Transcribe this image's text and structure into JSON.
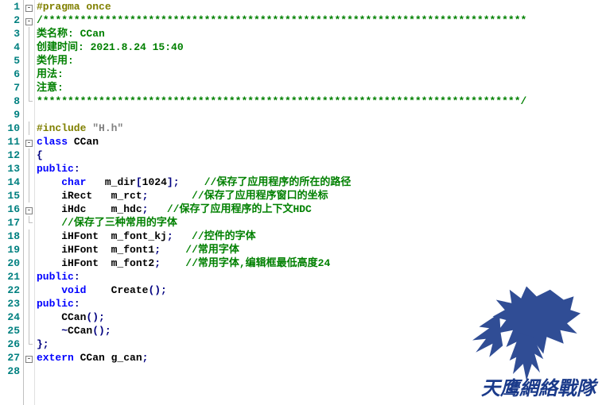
{
  "lines": [
    {
      "n": 1,
      "fold": "box",
      "segs": [
        {
          "c": "pp",
          "t": "#pragma once"
        }
      ]
    },
    {
      "n": 2,
      "fold": "box",
      "segs": [
        {
          "c": "cm",
          "t": "/******************************************************************************"
        }
      ]
    },
    {
      "n": 3,
      "fold": "line",
      "segs": [
        {
          "c": "cm",
          "t": "类名称: CCan"
        }
      ]
    },
    {
      "n": 4,
      "fold": "line",
      "segs": [
        {
          "c": "cm",
          "t": "创建时间: 2021.8.24 15:40"
        }
      ]
    },
    {
      "n": 5,
      "fold": "line",
      "segs": [
        {
          "c": "cm",
          "t": "类作用:"
        }
      ]
    },
    {
      "n": 6,
      "fold": "line",
      "segs": [
        {
          "c": "cm",
          "t": "用法:"
        }
      ]
    },
    {
      "n": 7,
      "fold": "line",
      "segs": [
        {
          "c": "cm",
          "t": "注意:"
        }
      ]
    },
    {
      "n": 8,
      "fold": "end",
      "segs": [
        {
          "c": "cm",
          "t": "******************************************************************************/"
        }
      ]
    },
    {
      "n": 9,
      "fold": "",
      "segs": []
    },
    {
      "n": 10,
      "fold": "line",
      "segs": [
        {
          "c": "pp",
          "t": "#include "
        },
        {
          "c": "str",
          "t": "\"H.h\""
        }
      ]
    },
    {
      "n": 11,
      "fold": "box",
      "segs": [
        {
          "c": "kw",
          "t": "class"
        },
        {
          "c": "id",
          "t": " CCan"
        }
      ]
    },
    {
      "n": 12,
      "fold": "line",
      "segs": [
        {
          "c": "pn",
          "t": "{"
        }
      ]
    },
    {
      "n": 13,
      "fold": "line",
      "segs": [
        {
          "c": "kw",
          "t": "public"
        },
        {
          "c": "pn",
          "t": ":"
        }
      ]
    },
    {
      "n": 14,
      "fold": "line",
      "segs": [
        {
          "c": "id",
          "t": "    "
        },
        {
          "c": "kw",
          "t": "char"
        },
        {
          "c": "id",
          "t": "   m_dir"
        },
        {
          "c": "pn",
          "t": "["
        },
        {
          "c": "id",
          "t": "1024"
        },
        {
          "c": "pn",
          "t": "];"
        },
        {
          "c": "id",
          "t": "    "
        },
        {
          "c": "cm",
          "t": "//保存了应用程序的所在的路径"
        }
      ]
    },
    {
      "n": 15,
      "fold": "line",
      "segs": [
        {
          "c": "id",
          "t": "    iRect   m_rct"
        },
        {
          "c": "pn",
          "t": ";"
        },
        {
          "c": "id",
          "t": "       "
        },
        {
          "c": "cm",
          "t": "//保存了应用程序窗口的坐标"
        }
      ]
    },
    {
      "n": 16,
      "fold": "box",
      "segs": [
        {
          "c": "id",
          "t": "    iHdc    m_hdc"
        },
        {
          "c": "pn",
          "t": ";"
        },
        {
          "c": "id",
          "t": "   "
        },
        {
          "c": "cm",
          "t": "//保存了应用程序的上下文HDC"
        }
      ]
    },
    {
      "n": 17,
      "fold": "end",
      "segs": [
        {
          "c": "id",
          "t": "    "
        },
        {
          "c": "cm",
          "t": "//保存了三种常用的字体"
        }
      ]
    },
    {
      "n": 18,
      "fold": "line",
      "segs": [
        {
          "c": "id",
          "t": "    iHFont  m_font_kj"
        },
        {
          "c": "pn",
          "t": ";"
        },
        {
          "c": "id",
          "t": "   "
        },
        {
          "c": "cm",
          "t": "//控件的字体"
        }
      ]
    },
    {
      "n": 19,
      "fold": "line",
      "segs": [
        {
          "c": "id",
          "t": "    iHFont  m_font1"
        },
        {
          "c": "pn",
          "t": ";"
        },
        {
          "c": "id",
          "t": "    "
        },
        {
          "c": "cm",
          "t": "//常用字体"
        }
      ]
    },
    {
      "n": 20,
      "fold": "line",
      "segs": [
        {
          "c": "id",
          "t": "    iHFont  m_font2"
        },
        {
          "c": "pn",
          "t": ";"
        },
        {
          "c": "id",
          "t": "    "
        },
        {
          "c": "cm",
          "t": "//常用字体,编辑框最低高度24"
        }
      ]
    },
    {
      "n": 21,
      "fold": "line",
      "segs": [
        {
          "c": "kw",
          "t": "public"
        },
        {
          "c": "pn",
          "t": ":"
        }
      ]
    },
    {
      "n": 22,
      "fold": "line",
      "segs": [
        {
          "c": "id",
          "t": "    "
        },
        {
          "c": "kw",
          "t": "void"
        },
        {
          "c": "id",
          "t": "    Create"
        },
        {
          "c": "pn",
          "t": "();"
        }
      ]
    },
    {
      "n": 23,
      "fold": "line",
      "segs": [
        {
          "c": "kw",
          "t": "public"
        },
        {
          "c": "pn",
          "t": ":"
        }
      ]
    },
    {
      "n": 24,
      "fold": "line",
      "segs": [
        {
          "c": "id",
          "t": "    CCan"
        },
        {
          "c": "pn",
          "t": "();"
        }
      ]
    },
    {
      "n": 25,
      "fold": "line",
      "segs": [
        {
          "c": "id",
          "t": "    "
        },
        {
          "c": "pn",
          "t": "~"
        },
        {
          "c": "id",
          "t": "CCan"
        },
        {
          "c": "pn",
          "t": "();"
        }
      ]
    },
    {
      "n": 26,
      "fold": "end",
      "segs": [
        {
          "c": "pn",
          "t": "};"
        }
      ]
    },
    {
      "n": 27,
      "fold": "box",
      "segs": [
        {
          "c": "kw",
          "t": "extern"
        },
        {
          "c": "id",
          "t": " CCan g_can"
        },
        {
          "c": "pn",
          "t": ";"
        }
      ]
    },
    {
      "n": 28,
      "fold": "",
      "segs": []
    }
  ],
  "watermark_text": "天鹰網絡戰隊"
}
